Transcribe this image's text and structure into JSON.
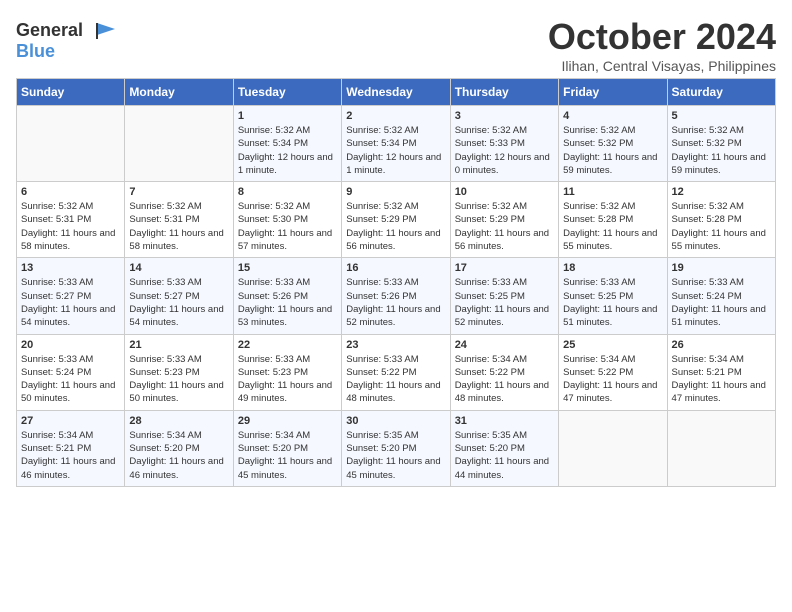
{
  "header": {
    "logo_general": "General",
    "logo_blue": "Blue",
    "month_title": "October 2024",
    "location": "Ilihan, Central Visayas, Philippines"
  },
  "calendar": {
    "days_of_week": [
      "Sunday",
      "Monday",
      "Tuesday",
      "Wednesday",
      "Thursday",
      "Friday",
      "Saturday"
    ],
    "weeks": [
      [
        {
          "day": "",
          "info": ""
        },
        {
          "day": "",
          "info": ""
        },
        {
          "day": "1",
          "info": "Sunrise: 5:32 AM\nSunset: 5:34 PM\nDaylight: 12 hours and 1 minute."
        },
        {
          "day": "2",
          "info": "Sunrise: 5:32 AM\nSunset: 5:34 PM\nDaylight: 12 hours and 1 minute."
        },
        {
          "day": "3",
          "info": "Sunrise: 5:32 AM\nSunset: 5:33 PM\nDaylight: 12 hours and 0 minutes."
        },
        {
          "day": "4",
          "info": "Sunrise: 5:32 AM\nSunset: 5:32 PM\nDaylight: 11 hours and 59 minutes."
        },
        {
          "day": "5",
          "info": "Sunrise: 5:32 AM\nSunset: 5:32 PM\nDaylight: 11 hours and 59 minutes."
        }
      ],
      [
        {
          "day": "6",
          "info": "Sunrise: 5:32 AM\nSunset: 5:31 PM\nDaylight: 11 hours and 58 minutes."
        },
        {
          "day": "7",
          "info": "Sunrise: 5:32 AM\nSunset: 5:31 PM\nDaylight: 11 hours and 58 minutes."
        },
        {
          "day": "8",
          "info": "Sunrise: 5:32 AM\nSunset: 5:30 PM\nDaylight: 11 hours and 57 minutes."
        },
        {
          "day": "9",
          "info": "Sunrise: 5:32 AM\nSunset: 5:29 PM\nDaylight: 11 hours and 56 minutes."
        },
        {
          "day": "10",
          "info": "Sunrise: 5:32 AM\nSunset: 5:29 PM\nDaylight: 11 hours and 56 minutes."
        },
        {
          "day": "11",
          "info": "Sunrise: 5:32 AM\nSunset: 5:28 PM\nDaylight: 11 hours and 55 minutes."
        },
        {
          "day": "12",
          "info": "Sunrise: 5:32 AM\nSunset: 5:28 PM\nDaylight: 11 hours and 55 minutes."
        }
      ],
      [
        {
          "day": "13",
          "info": "Sunrise: 5:33 AM\nSunset: 5:27 PM\nDaylight: 11 hours and 54 minutes."
        },
        {
          "day": "14",
          "info": "Sunrise: 5:33 AM\nSunset: 5:27 PM\nDaylight: 11 hours and 54 minutes."
        },
        {
          "day": "15",
          "info": "Sunrise: 5:33 AM\nSunset: 5:26 PM\nDaylight: 11 hours and 53 minutes."
        },
        {
          "day": "16",
          "info": "Sunrise: 5:33 AM\nSunset: 5:26 PM\nDaylight: 11 hours and 52 minutes."
        },
        {
          "day": "17",
          "info": "Sunrise: 5:33 AM\nSunset: 5:25 PM\nDaylight: 11 hours and 52 minutes."
        },
        {
          "day": "18",
          "info": "Sunrise: 5:33 AM\nSunset: 5:25 PM\nDaylight: 11 hours and 51 minutes."
        },
        {
          "day": "19",
          "info": "Sunrise: 5:33 AM\nSunset: 5:24 PM\nDaylight: 11 hours and 51 minutes."
        }
      ],
      [
        {
          "day": "20",
          "info": "Sunrise: 5:33 AM\nSunset: 5:24 PM\nDaylight: 11 hours and 50 minutes."
        },
        {
          "day": "21",
          "info": "Sunrise: 5:33 AM\nSunset: 5:23 PM\nDaylight: 11 hours and 50 minutes."
        },
        {
          "day": "22",
          "info": "Sunrise: 5:33 AM\nSunset: 5:23 PM\nDaylight: 11 hours and 49 minutes."
        },
        {
          "day": "23",
          "info": "Sunrise: 5:33 AM\nSunset: 5:22 PM\nDaylight: 11 hours and 48 minutes."
        },
        {
          "day": "24",
          "info": "Sunrise: 5:34 AM\nSunset: 5:22 PM\nDaylight: 11 hours and 48 minutes."
        },
        {
          "day": "25",
          "info": "Sunrise: 5:34 AM\nSunset: 5:22 PM\nDaylight: 11 hours and 47 minutes."
        },
        {
          "day": "26",
          "info": "Sunrise: 5:34 AM\nSunset: 5:21 PM\nDaylight: 11 hours and 47 minutes."
        }
      ],
      [
        {
          "day": "27",
          "info": "Sunrise: 5:34 AM\nSunset: 5:21 PM\nDaylight: 11 hours and 46 minutes."
        },
        {
          "day": "28",
          "info": "Sunrise: 5:34 AM\nSunset: 5:20 PM\nDaylight: 11 hours and 46 minutes."
        },
        {
          "day": "29",
          "info": "Sunrise: 5:34 AM\nSunset: 5:20 PM\nDaylight: 11 hours and 45 minutes."
        },
        {
          "day": "30",
          "info": "Sunrise: 5:35 AM\nSunset: 5:20 PM\nDaylight: 11 hours and 45 minutes."
        },
        {
          "day": "31",
          "info": "Sunrise: 5:35 AM\nSunset: 5:20 PM\nDaylight: 11 hours and 44 minutes."
        },
        {
          "day": "",
          "info": ""
        },
        {
          "day": "",
          "info": ""
        }
      ]
    ]
  }
}
